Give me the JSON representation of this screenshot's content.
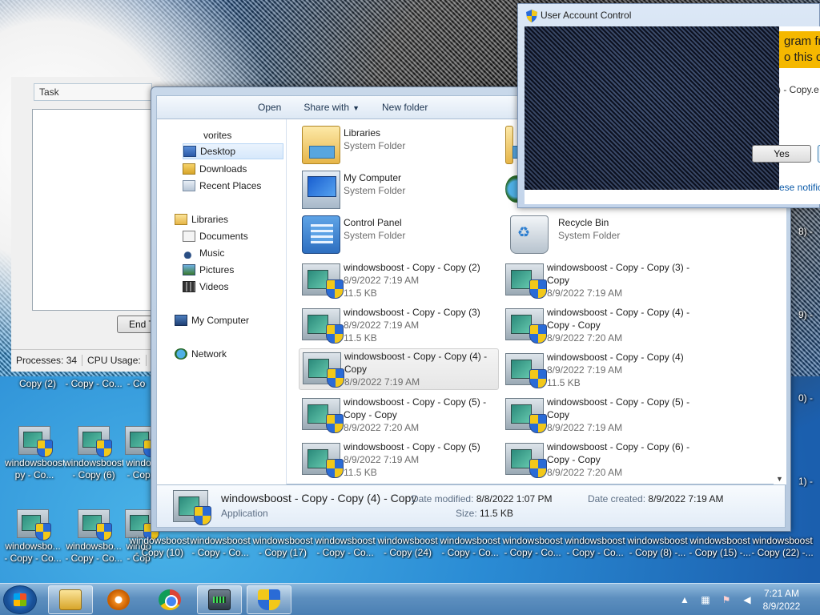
{
  "task_manager": {
    "title_fragment": "Task",
    "end_button_fragment": "End T",
    "processes": "Processes: 34",
    "cpu_usage": "CPU Usage:"
  },
  "explorer": {
    "toolbar": {
      "open": "Open",
      "share_with": "Share with",
      "new_folder": "New folder"
    },
    "nav": {
      "favorites": "vorites",
      "desktop": "Desktop",
      "downloads": "Downloads",
      "recent_places": "Recent Places",
      "libraries": "Libraries",
      "documents": "Documents",
      "music": "Music",
      "pictures": "Pictures",
      "videos": "Videos",
      "my_computer": "My Computer",
      "network": "Network"
    },
    "items": [
      {
        "name": "Libraries",
        "l2": "System Folder",
        "l3": ""
      },
      {
        "name": "My Computer",
        "l2": "System Folder",
        "l3": ""
      },
      {
        "name": "Control Panel",
        "l2": "System Folder",
        "l3": ""
      },
      {
        "name": "Recycle Bin",
        "l2": "System Folder",
        "l3": ""
      },
      {
        "name": "windowsboost - Copy - Copy (2)",
        "l2": "8/9/2022 7:19 AM",
        "l3": "11.5 KB"
      },
      {
        "name": "windowsboost - Copy - Copy (3) -",
        "l2": "Copy",
        "l3": "8/9/2022 7:19 AM"
      },
      {
        "name": "windowsboost - Copy - Copy (3)",
        "l2": "8/9/2022 7:19 AM",
        "l3": "11.5 KB"
      },
      {
        "name": "windowsboost - Copy - Copy (4) -",
        "l2": "Copy - Copy",
        "l3": "8/9/2022 7:20 AM"
      },
      {
        "name": "windowsboost - Copy - Copy (4) -",
        "l2": "Copy",
        "l3": "8/9/2022 7:19 AM"
      },
      {
        "name": "windowsboost - Copy - Copy (4)",
        "l2": "8/9/2022 7:19 AM",
        "l3": "11.5 KB"
      },
      {
        "name": "windowsboost - Copy - Copy (5) -",
        "l2": "Copy - Copy",
        "l3": "8/9/2022 7:20 AM"
      },
      {
        "name": "windowsboost - Copy - Copy (5) -",
        "l2": "Copy",
        "l3": "8/9/2022 7:19 AM"
      },
      {
        "name": "windowsboost - Copy - Copy (5)",
        "l2": "8/9/2022 7:19 AM",
        "l3": "11.5 KB"
      },
      {
        "name": "windowsboost - Copy - Copy (6) -",
        "l2": "Copy - Copy",
        "l3": "8/9/2022 7:20 AM"
      }
    ],
    "details": {
      "name": "windowsboost - Copy - Copy (4) - Copy",
      "type": "Application",
      "date_modified_label": "Date modified:",
      "date_modified": "8/8/2022 1:07 PM",
      "size_label": "Size:",
      "size": "11.5 KB",
      "date_created_label": "Date created:",
      "date_created": "8/9/2022 7:19 AM"
    }
  },
  "uac": {
    "title": "User Account Control",
    "banner_line1": "gram fr",
    "banner_line2": "o this co",
    "file_fragment": ") - Copy.e",
    "yes": "Yes",
    "notification_fragment": "ese notific"
  },
  "desktop_icons": {
    "row1": [
      "Copy (2)",
      "- Copy - Co...",
      "- Co"
    ],
    "row2a": [
      "windowsboost",
      "windowsboost",
      "windo"
    ],
    "row2b": [
      "py - Co...",
      "- Copy (6)",
      "- Cop"
    ],
    "row3a": [
      "windowsbo...",
      "windowsbo...",
      "windo",
      "windowsboost",
      "windowsboost",
      "windowsboost",
      "windowsboost",
      "windowsboost",
      "windowsboost",
      "windowsboost",
      "windowsboost",
      "windowsboost",
      "windowsboost"
    ],
    "row3b": [
      "- Copy - Co...",
      "- Copy - Co...",
      "- Cop",
      "- Copy (10)",
      "- Copy - Co...",
      "- Copy (17)",
      "- Copy - Co...",
      "- Copy (24)",
      "- Copy - Co...",
      "- Copy - Co...",
      "- Copy - Co...",
      "- Copy (8) -...",
      "- Copy (15) -...",
      "- Copy (22) -..."
    ],
    "right_column": [
      "8) -",
      "9) -",
      "0) -",
      "1) -"
    ]
  },
  "taskbar": {
    "time": "7:21 AM",
    "date": "8/9/2022"
  }
}
